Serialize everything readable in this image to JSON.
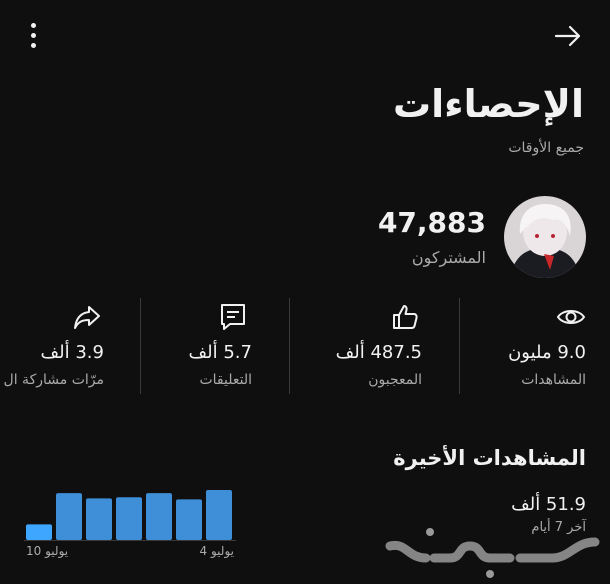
{
  "header": {
    "title": "الإحصاءات",
    "subtitle": "جميع الأوقات",
    "menu_icon": "more-vertical-icon",
    "back_icon": "arrow-right-icon"
  },
  "channel": {
    "subscriber_count": "47,883",
    "subscriber_label": "المشتركون"
  },
  "stats": {
    "views": {
      "value": "9.0 مليون",
      "label": "المشاهدات",
      "icon": "eye-icon"
    },
    "likes": {
      "value": "487.5 ألف",
      "label": "المعجبون",
      "icon": "thumbs-up-icon"
    },
    "comments": {
      "value": "5.7 ألف",
      "label": "التعليقات",
      "icon": "comment-icon"
    },
    "shares": {
      "value": "3.9 ألف",
      "label": "مرّات مشاركة ال",
      "icon": "share-icon"
    }
  },
  "recent": {
    "title": "المشاهدات الأخيرة",
    "value": "51.9 ألف",
    "period": "آخر 7 أيام"
  },
  "chart_data": {
    "type": "bar",
    "categories": [
      "10 يوليو",
      "",
      "",
      "",
      "",
      "",
      "4 يوليو"
    ],
    "values": [
      15,
      45,
      40,
      41,
      45,
      39,
      48
    ],
    "tick_labels": [
      "10 يوليو",
      "4 يوليو"
    ],
    "colors": {
      "primary": "#3e8ed8",
      "first": "#3ea6ff"
    }
  },
  "watermark": {
    "text": "حراج"
  },
  "colors": {
    "background": "#0f0f0f",
    "text": "#f1f1f1",
    "muted": "#aaaaaa",
    "accent": "#3e8ed8"
  }
}
